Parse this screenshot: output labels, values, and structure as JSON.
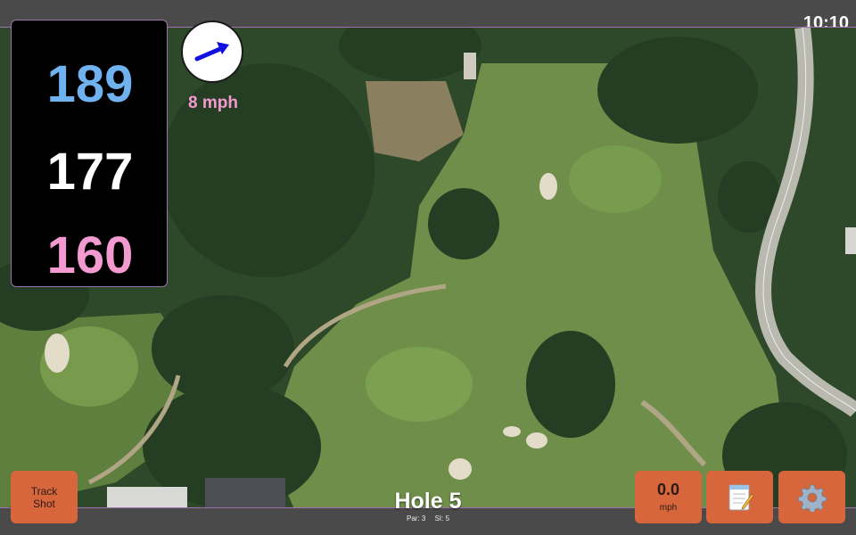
{
  "status": {
    "time": "10:10"
  },
  "distances": {
    "back": "189",
    "middle": "177",
    "front": "160"
  },
  "wind": {
    "speed": "8 mph",
    "direction_icon": "wind-arrow-icon"
  },
  "hole": {
    "title": "Hole 5",
    "par": "Par: 3",
    "stroke_index": "SI: 5"
  },
  "controls": {
    "track_shot_line1": "Track",
    "track_shot_line2": "Shot",
    "speed_value": "0.0",
    "speed_unit": "mph",
    "notes_icon": "notepad-icon",
    "settings_icon": "gear-icon"
  },
  "colors": {
    "back": "#6fb2ef",
    "middle": "#ffffff",
    "front": "#f39ad1",
    "button": "#d8663d"
  }
}
